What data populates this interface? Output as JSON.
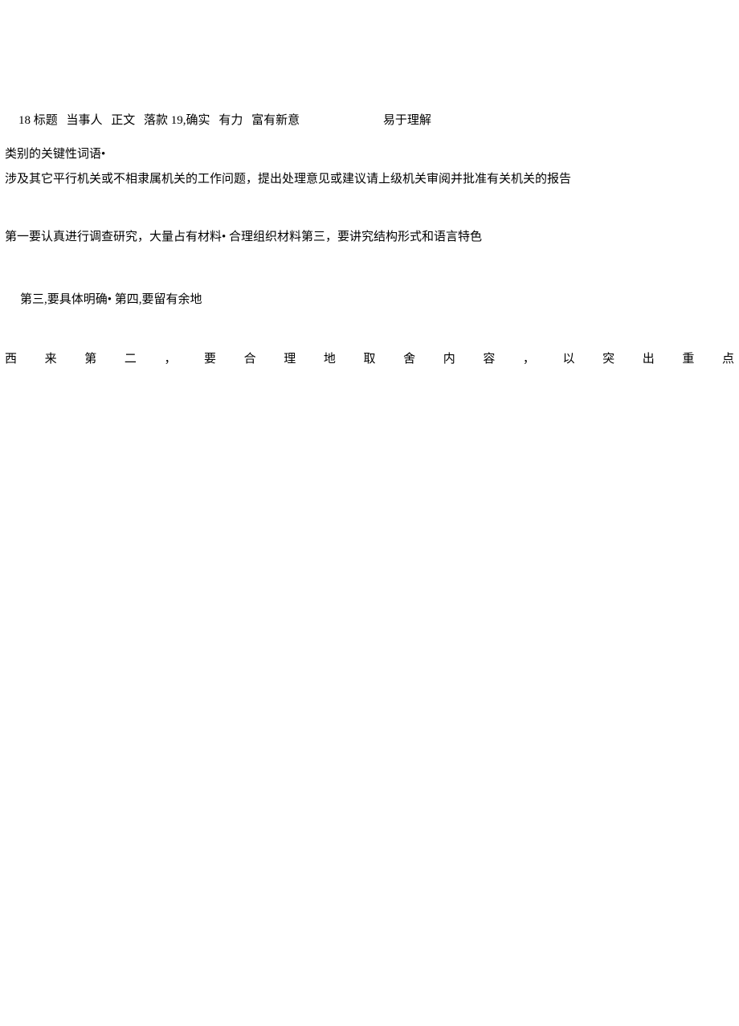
{
  "line1": {
    "parts": [
      "18 标题",
      "当事人",
      "正文",
      "落款 19,确实",
      "有力",
      "富有新意",
      "易于理解"
    ]
  },
  "line2": "类别的关键性词语•",
  "line3": "涉及其它平行机关或不相隶属机关的工作问题，提出处理意见或建议请上级机关审阅并批准有关机关的报告",
  "line4": "第一要认真进行调查研究，大量占有材料• 合理组织材料第三，要讲究结构形式和语言特色",
  "line5": "第三,要具体明确• 第四,要留有余地",
  "line6": {
    "chars": [
      "西",
      "来",
      "第",
      "二",
      "，",
      "要",
      "合",
      "理",
      "地",
      "取",
      "舍",
      "内",
      "容",
      "，",
      "以",
      "突",
      "出",
      "重",
      "点"
    ]
  }
}
